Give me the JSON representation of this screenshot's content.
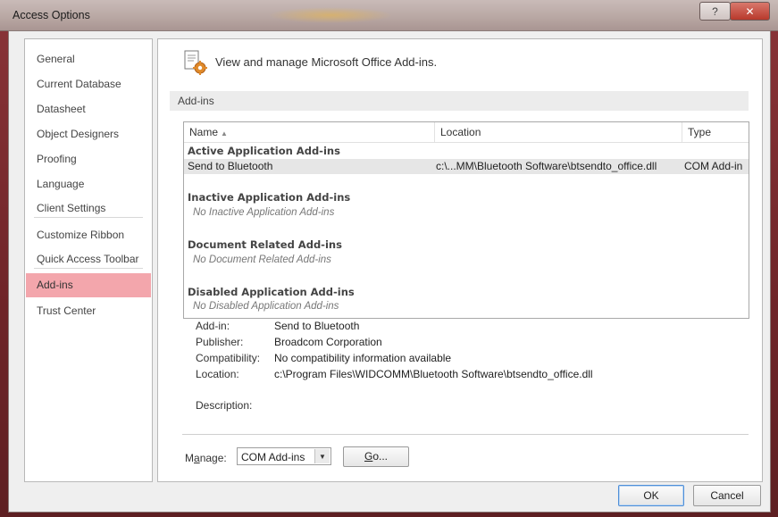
{
  "window": {
    "title": "Access Options",
    "help_label": "?",
    "close_label": "✕"
  },
  "sidebar": {
    "items": [
      {
        "label": "General"
      },
      {
        "label": "Current Database"
      },
      {
        "label": "Datasheet"
      },
      {
        "label": "Object Designers"
      },
      {
        "label": "Proofing"
      },
      {
        "label": "Language"
      },
      {
        "label": "Client Settings"
      },
      {
        "label": "Customize Ribbon"
      },
      {
        "label": "Quick Access Toolbar"
      },
      {
        "label": "Add-ins",
        "selected": true
      },
      {
        "label": "Trust Center"
      }
    ]
  },
  "header": {
    "title": "View and manage Microsoft Office Add-ins."
  },
  "section": {
    "title": "Add-ins"
  },
  "table": {
    "columns": [
      "Name",
      "Location",
      "Type"
    ],
    "groups": [
      {
        "title": "Active Application Add-ins",
        "rows": [
          {
            "name": "Send to Bluetooth",
            "location": "c:\\...MM\\Bluetooth Software\\btsendto_office.dll",
            "type": "COM Add-in"
          }
        ]
      },
      {
        "title": "Inactive Application Add-ins",
        "empty": "No Inactive Application Add-ins"
      },
      {
        "title": "Document Related Add-ins",
        "empty": "No Document Related Add-ins"
      },
      {
        "title": "Disabled Application Add-ins",
        "empty": "No Disabled Application Add-ins"
      }
    ]
  },
  "details": {
    "addin_label": "Add-in:",
    "addin_value": "Send to Bluetooth",
    "publisher_label": "Publisher:",
    "publisher_value": "Broadcom Corporation",
    "compat_label": "Compatibility:",
    "compat_value": "No compatibility information available",
    "location_label": "Location:",
    "location_value": "c:\\Program Files\\WIDCOMM\\Bluetooth Software\\btsendto_office.dll",
    "description_label": "Description:"
  },
  "manage": {
    "label_pre": "M",
    "label_u": "a",
    "label_post": "nage:",
    "selected": "COM Add-ins",
    "go_u": "G",
    "go_post": "o..."
  },
  "footer": {
    "ok_label": "OK",
    "cancel_label": "Cancel"
  }
}
